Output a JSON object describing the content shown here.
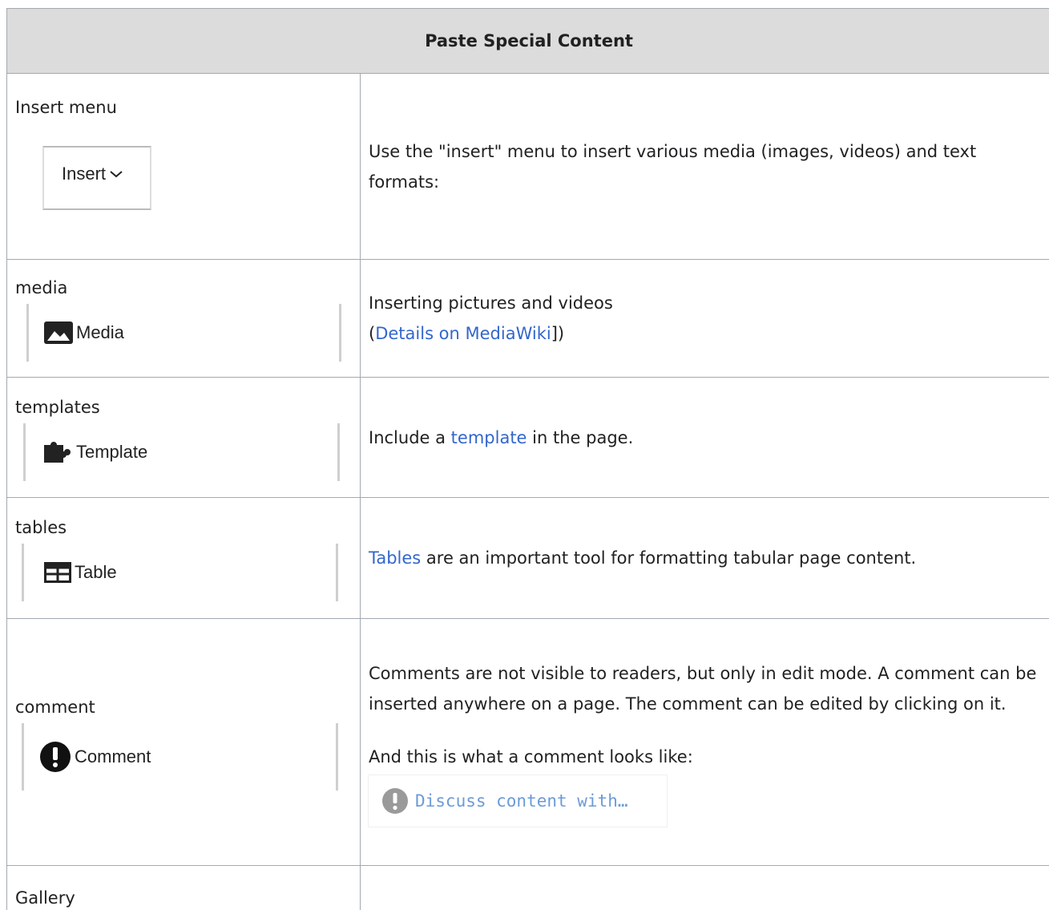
{
  "table": {
    "header": "Paste Special Content",
    "rows": [
      {
        "label": "Insert menu",
        "image_text": "Insert",
        "icon": "chevron-down-icon",
        "description": "Use the \"insert\" menu to insert various media (images, videos) and text formats:"
      },
      {
        "label": "media",
        "image_text": "Media",
        "icon": "image-icon",
        "description_line1": "Inserting pictures and videos",
        "description_open": "(",
        "link": "Details on MediaWiki",
        "description_close": "])"
      },
      {
        "label": "templates",
        "image_text": "Template",
        "icon": "puzzle-icon",
        "description_before": "Include a ",
        "link": "template",
        "description_after": " in the page."
      },
      {
        "label": "tables",
        "image_text": "Table",
        "icon": "table-icon",
        "link": "Tables",
        "description_after": " are an important tool for formatting tabular page content."
      },
      {
        "label": "comment",
        "image_text": "Comment",
        "icon": "exclamation-icon",
        "description": "Comments are not visible to readers, but only in edit mode. A comment can be inserted anywhere on a page. The comment can be edited by clicking on it.",
        "description2": "And this is what a comment looks like:",
        "sample_text": "Discuss content with…"
      },
      {
        "label": "Gallery"
      }
    ]
  },
  "colors": {
    "header_bg": "#dcdcdc",
    "border": "#a2a9b1",
    "link": "#3366cc",
    "comment_sample_text": "#6c9bd6"
  }
}
